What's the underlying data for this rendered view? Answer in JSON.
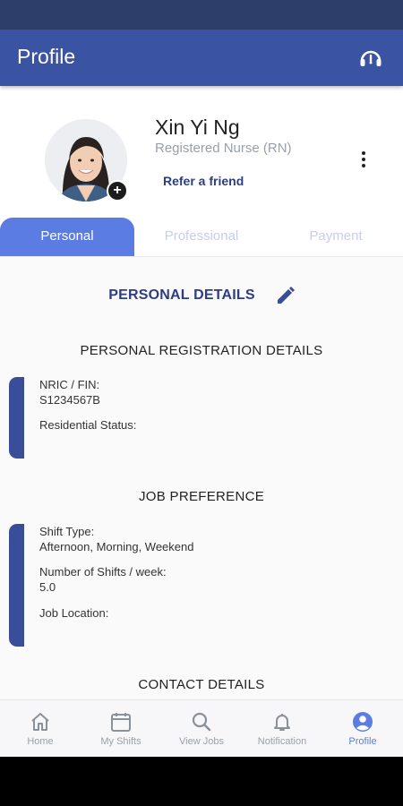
{
  "app": {
    "title": "Profile"
  },
  "profile": {
    "name": "Xin Yi Ng",
    "role": "Registered Nurse (RN)",
    "refer_label": "Refer a friend"
  },
  "tabs": [
    {
      "label": "Personal",
      "active": true
    },
    {
      "label": "Professional",
      "active": false
    },
    {
      "label": "Payment",
      "active": false
    }
  ],
  "personal_details": {
    "title": "PERSONAL DETAILS",
    "registration": {
      "title": "PERSONAL REGISTRATION DETAILS",
      "nric_label": "NRIC / FIN:",
      "nric_value": "S1234567B",
      "residential_label": "Residential Status:"
    },
    "job_preference": {
      "title": "JOB PREFERENCE",
      "shift_type_label": "Shift Type:",
      "shift_type_value": "Afternoon, Morning, Weekend",
      "shifts_week_label": "Number of Shifts / week:",
      "shifts_week_value": "5.0",
      "job_location_label": "Job Location:"
    },
    "contact": {
      "title": "CONTACT DETAILS"
    }
  },
  "nav": [
    {
      "label": "Home",
      "icon": "home-icon",
      "active": false
    },
    {
      "label": "My Shifts",
      "icon": "calendar-icon",
      "active": false
    },
    {
      "label": "View Jobs",
      "icon": "search-icon",
      "active": false
    },
    {
      "label": "Notification",
      "icon": "bell-icon",
      "active": false
    },
    {
      "label": "Profile",
      "icon": "account-circle-icon",
      "active": true
    }
  ],
  "colors": {
    "status_bar": "#2d3e6a",
    "app_bar": "#3a53a2",
    "accent": "#5b7de3",
    "heading": "#2e3d83",
    "card_bar": "#3a4d99"
  }
}
